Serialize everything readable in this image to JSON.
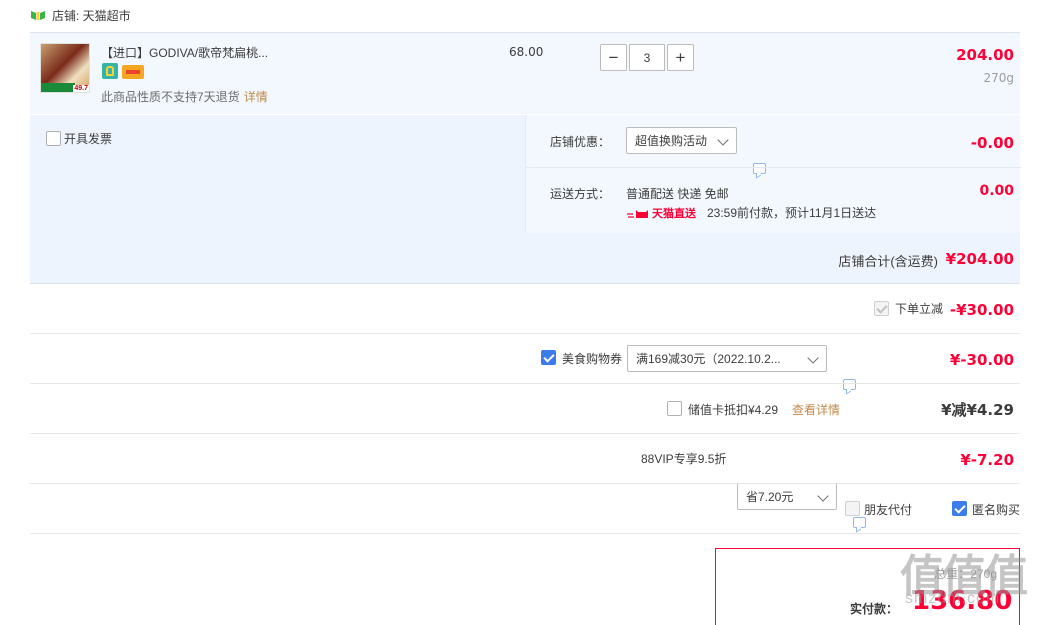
{
  "shop": {
    "label": "店铺: 天猫超市"
  },
  "item": {
    "title": "【进口】GODIVA/歌帝梵扁桃...",
    "thumb_badge": "49.7",
    "note": "此商品性质不支持7天退货",
    "note_link": "详情",
    "unit_price": "68.00",
    "qty_minus": "−",
    "qty_value": "3",
    "qty_plus": "+",
    "subtotal": "204.00",
    "weight": "270g"
  },
  "invoice": {
    "label": "开具发票"
  },
  "shop_discount": {
    "label": "店铺优惠：",
    "selected": "超值换购活动",
    "amount": "-0.00"
  },
  "shipping": {
    "label": "运送方式：",
    "method": "普通配送 快递 免邮",
    "tmall_badge": "天猫直送",
    "eta": "23:59前付款，预计11月1日送达",
    "amount": "0.00"
  },
  "shop_total": {
    "label": "店铺合计(含运费)",
    "amount": "¥204.00"
  },
  "order_discount": {
    "label": "下单立减",
    "amount": "-¥30.00"
  },
  "food_coupon": {
    "label": "美食购物券",
    "selected": "满169减30元（2022.10.2...",
    "amount": "¥-30.00"
  },
  "stored_card": {
    "label": "储值卡抵扣¥4.29",
    "link": "查看详情",
    "amount": "¥减¥4.29"
  },
  "vip": {
    "label": "88VIP专享9.5折",
    "selected": "省7.20元",
    "amount": "¥-7.20"
  },
  "options": {
    "friend_pay": "朋友代付",
    "anonymous": "匿名购买"
  },
  "payment": {
    "weight": "总重：270g",
    "label": "实付款：",
    "amount": "136.80"
  },
  "watermark": {
    "text": "值值值",
    "site": "smzdm.com"
  },
  "colors": {
    "price_red": "#ff0036",
    "check_blue": "#3b7bea",
    "row_blue": "#eef4fd"
  }
}
